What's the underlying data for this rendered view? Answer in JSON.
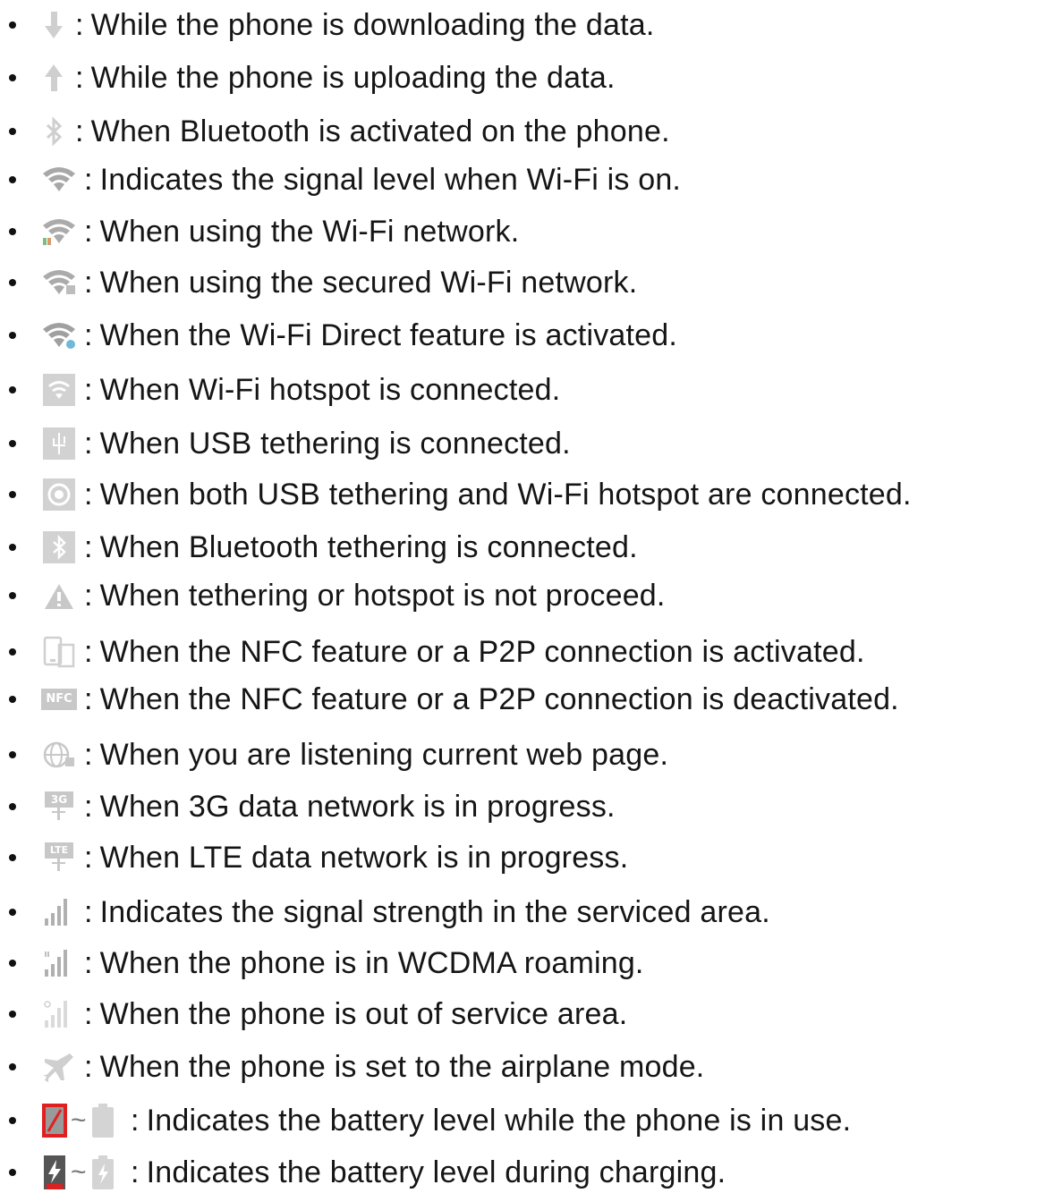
{
  "items": [
    {
      "icon": "download-arrow-icon",
      "text": "While the phone is downloading the data."
    },
    {
      "icon": "upload-arrow-icon",
      "text": "While the phone is uploading the data."
    },
    {
      "icon": "bluetooth-icon",
      "text": "When Bluetooth is activated on the phone."
    },
    {
      "icon": "wifi-signal-icon",
      "text": "Indicates the signal level when Wi-Fi is on."
    },
    {
      "icon": "wifi-in-use-icon",
      "text": "When using the Wi-Fi network."
    },
    {
      "icon": "wifi-secured-icon",
      "text": "When using the secured Wi-Fi network."
    },
    {
      "icon": "wifi-direct-icon",
      "text": "When the Wi-Fi Direct feature is activated."
    },
    {
      "icon": "wifi-hotspot-icon",
      "text": "When Wi-Fi hotspot is connected."
    },
    {
      "icon": "usb-tethering-icon",
      "text": "When USB tethering is connected."
    },
    {
      "icon": "usb-and-hotspot-icon",
      "text": "When both USB tethering and Wi-Fi hotspot are connected."
    },
    {
      "icon": "bluetooth-tethering-icon",
      "text": "When Bluetooth tethering is connected."
    },
    {
      "icon": "tethering-warning-icon",
      "text": "When tethering or hotspot is not proceed."
    },
    {
      "icon": "nfc-p2p-active-icon",
      "text": "When the NFC feature or a P2P connection is activated."
    },
    {
      "icon": "nfc-inactive-icon",
      "text": "When the NFC feature or a P2P connection is deactivated."
    },
    {
      "icon": "web-listening-icon",
      "text": "When you are listening current web page."
    },
    {
      "icon": "3g-data-icon",
      "text": "When 3G data network is in progress."
    },
    {
      "icon": "lte-data-icon",
      "text": "When LTE data network is in progress."
    },
    {
      "icon": "signal-strength-icon",
      "text": "Indicates the signal strength in the serviced area."
    },
    {
      "icon": "roaming-signal-icon",
      "text": "When the phone is in WCDMA roaming."
    },
    {
      "icon": "no-service-icon",
      "text": "When the phone is out of service area."
    },
    {
      "icon": "airplane-icon",
      "text": "When the phone is set to the airplane mode."
    },
    {
      "icon": "battery-level-range-icon",
      "text": "Indicates the battery level while the phone is in use."
    },
    {
      "icon": "battery-charging-range-icon",
      "text": "Indicates the battery level during charging."
    }
  ],
  "separator": ":",
  "range_symbol": "~",
  "nfc_badge_text": "NFC",
  "badge_3g": "3G",
  "badge_lte": "LTE",
  "colors": {
    "icon_gray": "#b9b9b9",
    "icon_light": "#d4d4d4",
    "battery_red": "#e02020",
    "text": "#151515"
  }
}
